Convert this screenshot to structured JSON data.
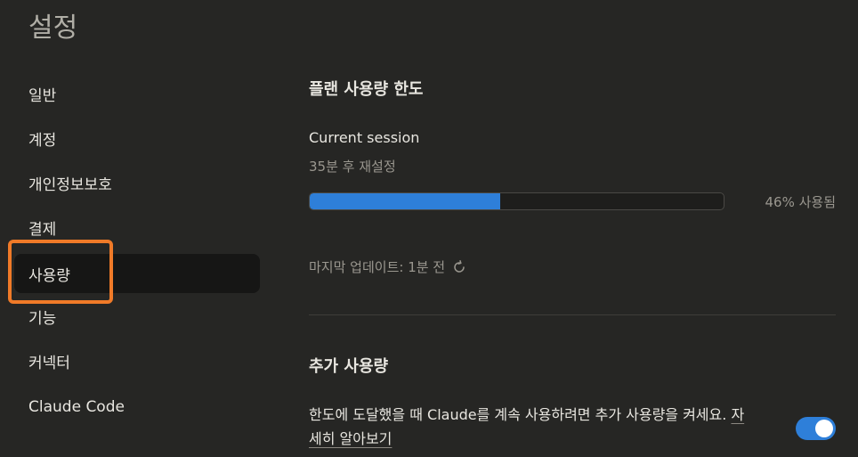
{
  "page": {
    "title": "설정"
  },
  "sidebar": {
    "items": [
      {
        "label": "일반"
      },
      {
        "label": "계정"
      },
      {
        "label": "개인정보보호"
      },
      {
        "label": "결제"
      },
      {
        "label": "사용량",
        "active": true
      },
      {
        "label": "기능"
      },
      {
        "label": "커넥터"
      },
      {
        "label": "Claude Code"
      }
    ]
  },
  "usage": {
    "title": "플랜 사용량 한도",
    "session_label": "Current session",
    "reset_text": "35분 후 재설정",
    "percent_used": 46,
    "percent_text": "46% 사용됨",
    "last_update": "마지막 업데이트: 1분 전",
    "refresh_icon": "refresh-icon"
  },
  "extra": {
    "title": "추가 사용량",
    "description": "한도에 도달했을 때 Claude를 계속 사용하려면 추가 사용량을 켜세요.",
    "link_text": "자세히 알아보기",
    "toggle_on": true
  },
  "colors": {
    "accent": "#2e7fd9",
    "highlight": "#f07a28",
    "background": "#262624"
  }
}
